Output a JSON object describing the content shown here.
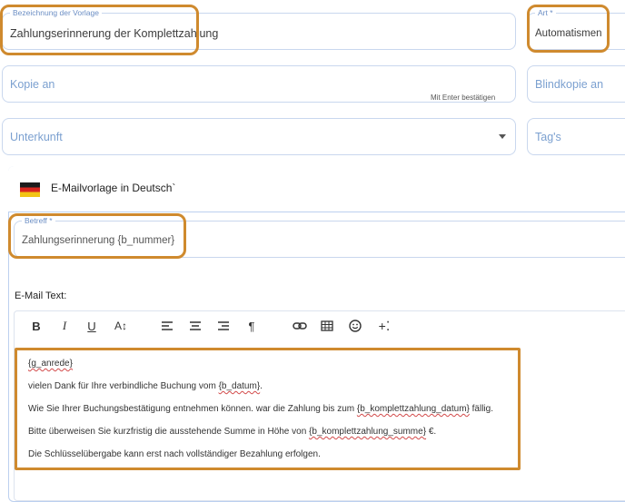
{
  "template_name": {
    "label": "Bezeichnung der Vorlage",
    "value": "Zahlungserinnerung der Komplettzahlung"
  },
  "type": {
    "label": "Art *",
    "value": "Automatismen"
  },
  "cc": {
    "placeholder": "Kopie an",
    "hint": "Mit Enter bestätigen"
  },
  "bcc": {
    "placeholder": "Blindkopie an"
  },
  "accommodation": {
    "placeholder": "Unterkunft"
  },
  "tags": {
    "placeholder": "Tag's"
  },
  "email_template": {
    "language_label": "E-Mailvorlage in Deutsch`",
    "subject_label": "Betreff *",
    "subject_value": "Zahlungserinnerung {b_nummer}",
    "body_label": "E-Mail Text:"
  },
  "toolbar": {
    "bold": "B",
    "italic": "I",
    "underline": "U",
    "font_size": "A↕"
  },
  "body_text": {
    "line1": "{g_anrede}",
    "line2_prefix": "vielen Dank für Ihre verbindliche Buchung vom ",
    "line2_var": "{b_datum}",
    "line2_suffix": ".",
    "line3_prefix": "Wie Sie Ihrer Buchungsbestätigung entnehmen können. war die Zahlung bis zum ",
    "line3_var": "{b_komplettzahlung_datum}",
    "line3_suffix": " fällig.",
    "line4_prefix": "Bitte überweisen Sie kurzfristig die ausstehende Summe in Höhe von ",
    "line4_var": "{b_komplettzahlung_summe}",
    "line4_suffix": " €.",
    "line5": "Die Schlüsselübergabe kann erst nach vollständiger Bezahlung erfolgen."
  },
  "colors": {
    "highlight": "#cf8a2e",
    "field_border": "#c9d7ee",
    "label_blue": "#6b8ec4"
  }
}
